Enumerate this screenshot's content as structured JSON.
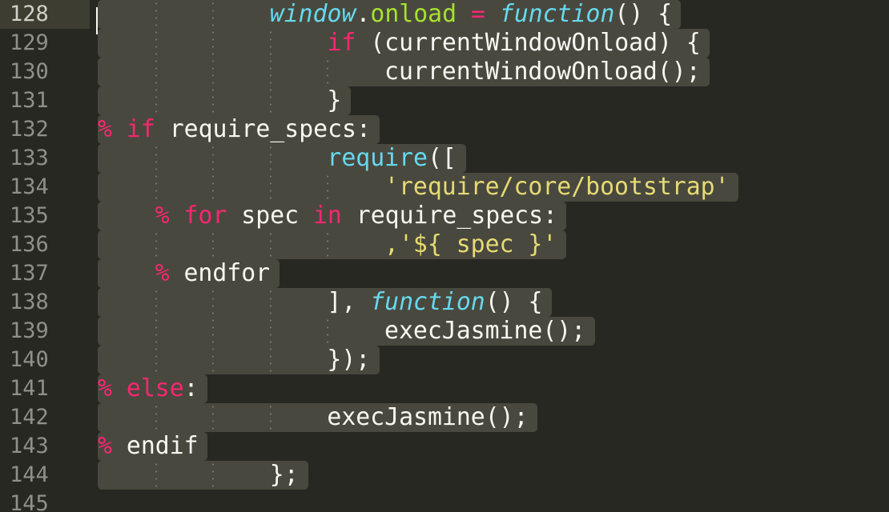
{
  "editor": {
    "gutter": {
      "line_numbers": [
        "128",
        "129",
        "130",
        "131",
        "132",
        "133",
        "134",
        "135",
        "136",
        "137",
        "138",
        "139",
        "140",
        "141",
        "142",
        "143",
        "144",
        "145"
      ],
      "active_line": "128"
    },
    "code_lines": [
      [
        {
          "t": "window",
          "c": "fn"
        },
        {
          "t": ".",
          "c": "pl"
        },
        {
          "t": "onload",
          "c": "prop"
        },
        {
          "t": " ",
          "c": "pl"
        },
        {
          "t": "=",
          "c": "kw"
        },
        {
          "t": " ",
          "c": "pl"
        },
        {
          "t": "function",
          "c": "fn"
        },
        {
          "t": "() {",
          "c": "pl"
        }
      ],
      [
        {
          "t": "if",
          "c": "kw"
        },
        {
          "t": " (currentWindowOnload) {",
          "c": "pl"
        }
      ],
      [
        {
          "t": "currentWindowOnload();",
          "c": "pl"
        }
      ],
      [
        {
          "t": "}",
          "c": "pl"
        }
      ],
      [
        {
          "t": "%",
          "c": "pct"
        },
        {
          "t": " ",
          "c": "pl"
        },
        {
          "t": "if",
          "c": "kw"
        },
        {
          "t": " require_specs:",
          "c": "pl"
        }
      ],
      [
        {
          "t": "require",
          "c": "call"
        },
        {
          "t": "([",
          "c": "pl"
        }
      ],
      [
        {
          "t": "'require/core/bootstrap'",
          "c": "str"
        }
      ],
      [
        {
          "t": "%",
          "c": "pct"
        },
        {
          "t": " ",
          "c": "pl"
        },
        {
          "t": "for",
          "c": "kw"
        },
        {
          "t": " spec ",
          "c": "pl"
        },
        {
          "t": "in",
          "c": "kw"
        },
        {
          "t": " require_specs:",
          "c": "pl"
        }
      ],
      [
        {
          "t": ",'",
          "c": "str"
        },
        {
          "t": "${ spec }",
          "c": "str"
        },
        {
          "t": "'",
          "c": "str"
        }
      ],
      [
        {
          "t": "%",
          "c": "pct"
        },
        {
          "t": " endfor",
          "c": "pl"
        }
      ],
      [
        {
          "t": "], ",
          "c": "pl"
        },
        {
          "t": "function",
          "c": "fn"
        },
        {
          "t": "() {",
          "c": "pl"
        }
      ],
      [
        {
          "t": "execJasmine();",
          "c": "pl"
        }
      ],
      [
        {
          "t": "});",
          "c": "pl"
        }
      ],
      [
        {
          "t": "%",
          "c": "pct"
        },
        {
          "t": " ",
          "c": "pl"
        },
        {
          "t": "else",
          "c": "kw"
        },
        {
          "t": ":",
          "c": "pl"
        }
      ],
      [
        {
          "t": "execJasmine();",
          "c": "pl"
        }
      ],
      [
        {
          "t": "%",
          "c": "pct"
        },
        {
          "t": " endif",
          "c": "pl"
        }
      ],
      [
        {
          "t": "};",
          "c": "pl"
        }
      ]
    ]
  },
  "theme": {
    "background": "#272822",
    "selection": "#49483e",
    "foreground": "#f8f8f2",
    "keyword": "#f92672",
    "storage_function": "#66d9ef",
    "property": "#a6e22e",
    "string": "#e6db74",
    "line_number": "#8f908a"
  }
}
